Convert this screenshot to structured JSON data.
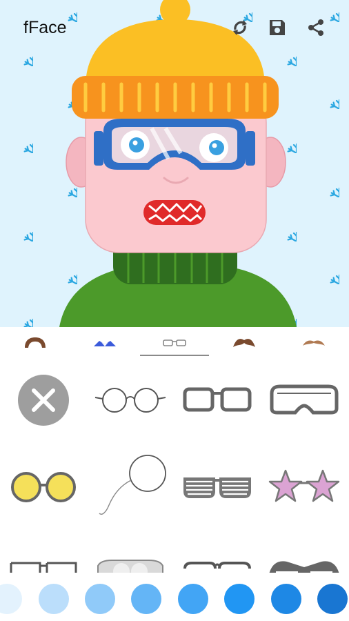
{
  "app": {
    "title": "fFace"
  },
  "toolbar": {
    "actions": [
      {
        "name": "randomize",
        "icon": "shuffle-icon"
      },
      {
        "name": "save",
        "icon": "save-icon"
      },
      {
        "name": "share",
        "icon": "share-icon"
      }
    ]
  },
  "categories": [
    {
      "id": "hair",
      "icon": "hair-icon"
    },
    {
      "id": "clothes",
      "icon": "shirt-icon"
    },
    {
      "id": "glasses",
      "icon": "glasses-icon",
      "selected": true
    },
    {
      "id": "mustache",
      "icon": "mustache-icon"
    },
    {
      "id": "thin-mustache",
      "icon": "thin-mustache-icon"
    }
  ],
  "glasses_options": [
    "none-option",
    "round-wire-glasses",
    "square-glasses",
    "ski-goggles",
    "yellow-round-sunglasses",
    "monocle",
    "shutter-shades",
    "pink-star-glasses",
    "browline-glasses",
    "aviator-glasses",
    "half-rim-glasses",
    "heavy-frame-glasses"
  ],
  "colors": [
    "#e3f2fd",
    "#bbdefb",
    "#90caf9",
    "#64b5f6",
    "#42a5f5",
    "#2196f3",
    "#1e88e5",
    "#1976d2"
  ]
}
